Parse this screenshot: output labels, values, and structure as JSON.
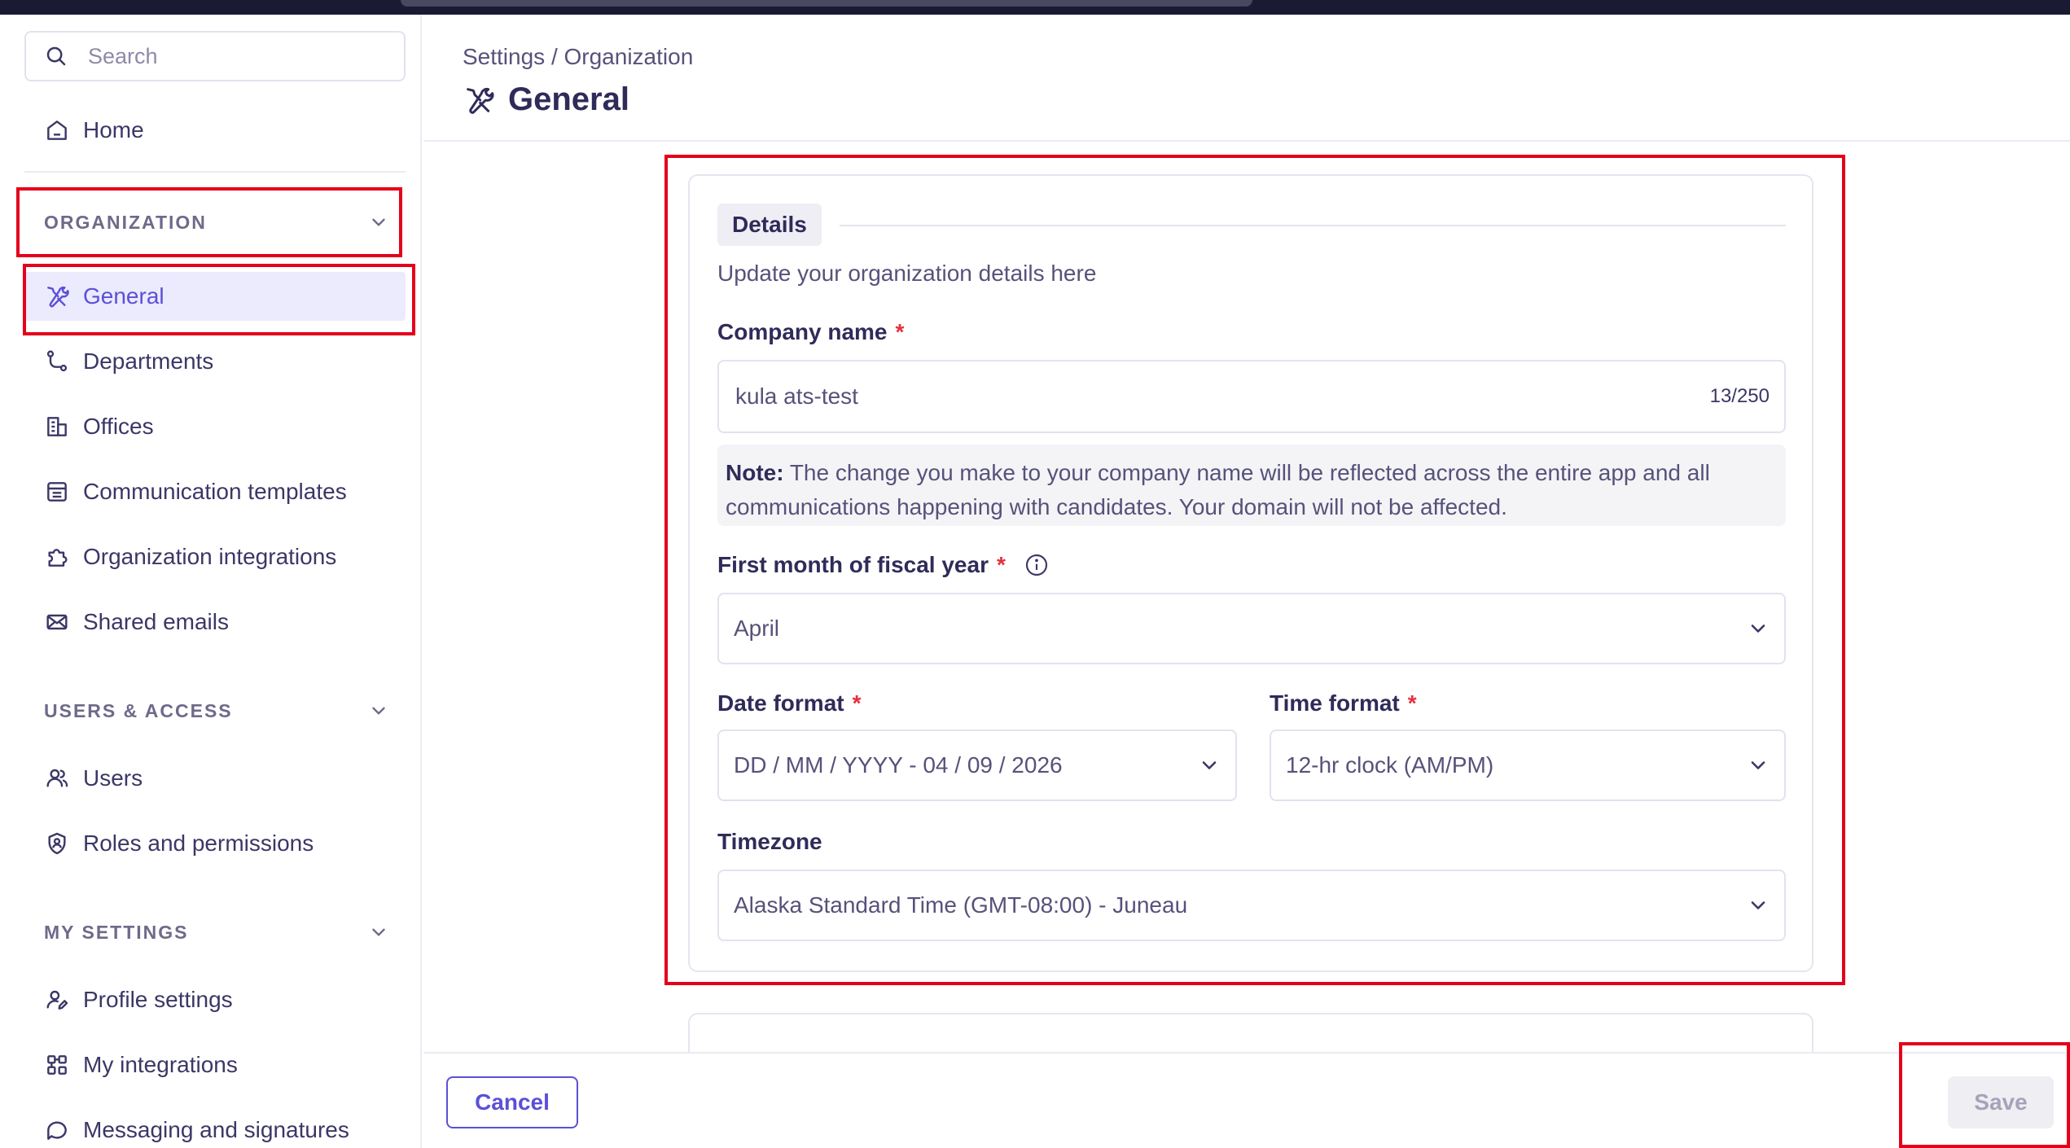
{
  "search": {
    "placeholder": "Search"
  },
  "sidebar": {
    "home": "Home",
    "organization": {
      "header": "ORGANIZATION",
      "items": [
        "General",
        "Departments",
        "Offices",
        "Communication templates",
        "Organization integrations",
        "Shared emails"
      ]
    },
    "users_access": {
      "header": "USERS & ACCESS",
      "items": [
        "Users",
        "Roles and permissions"
      ]
    },
    "my_settings": {
      "header": "MY SETTINGS",
      "items": [
        "Profile settings",
        "My integrations",
        "Messaging and signatures"
      ]
    }
  },
  "header": {
    "breadcrumb": "Settings / Organization",
    "title": "General"
  },
  "details": {
    "chip": "Details",
    "subtitle": "Update your organization details here",
    "company_name": {
      "label": "Company name",
      "required": "*",
      "value": "kula ats-test",
      "counter": "13/250"
    },
    "note": {
      "prefix": "Note:",
      "text": "The change you make to your company name will be reflected across the entire app and all communications happening with candidates. Your domain will not be affected."
    },
    "fiscal_month": {
      "label": "First month of fiscal year",
      "required": "*",
      "value": "April"
    },
    "date_format": {
      "label": "Date format",
      "required": "*",
      "value": "DD / MM / YYYY - 04 / 09 / 2026"
    },
    "time_format": {
      "label": "Time format",
      "required": "*",
      "value": "12-hr clock (AM/PM)"
    },
    "timezone": {
      "label": "Timezone",
      "value": "Alaska Standard Time (GMT-08:00) - Juneau"
    }
  },
  "footer": {
    "cancel": "Cancel",
    "save": "Save"
  },
  "colors": {
    "accent": "#5b50d6",
    "highlight_box": "#e5001b",
    "active_bg": "#eceafd"
  }
}
